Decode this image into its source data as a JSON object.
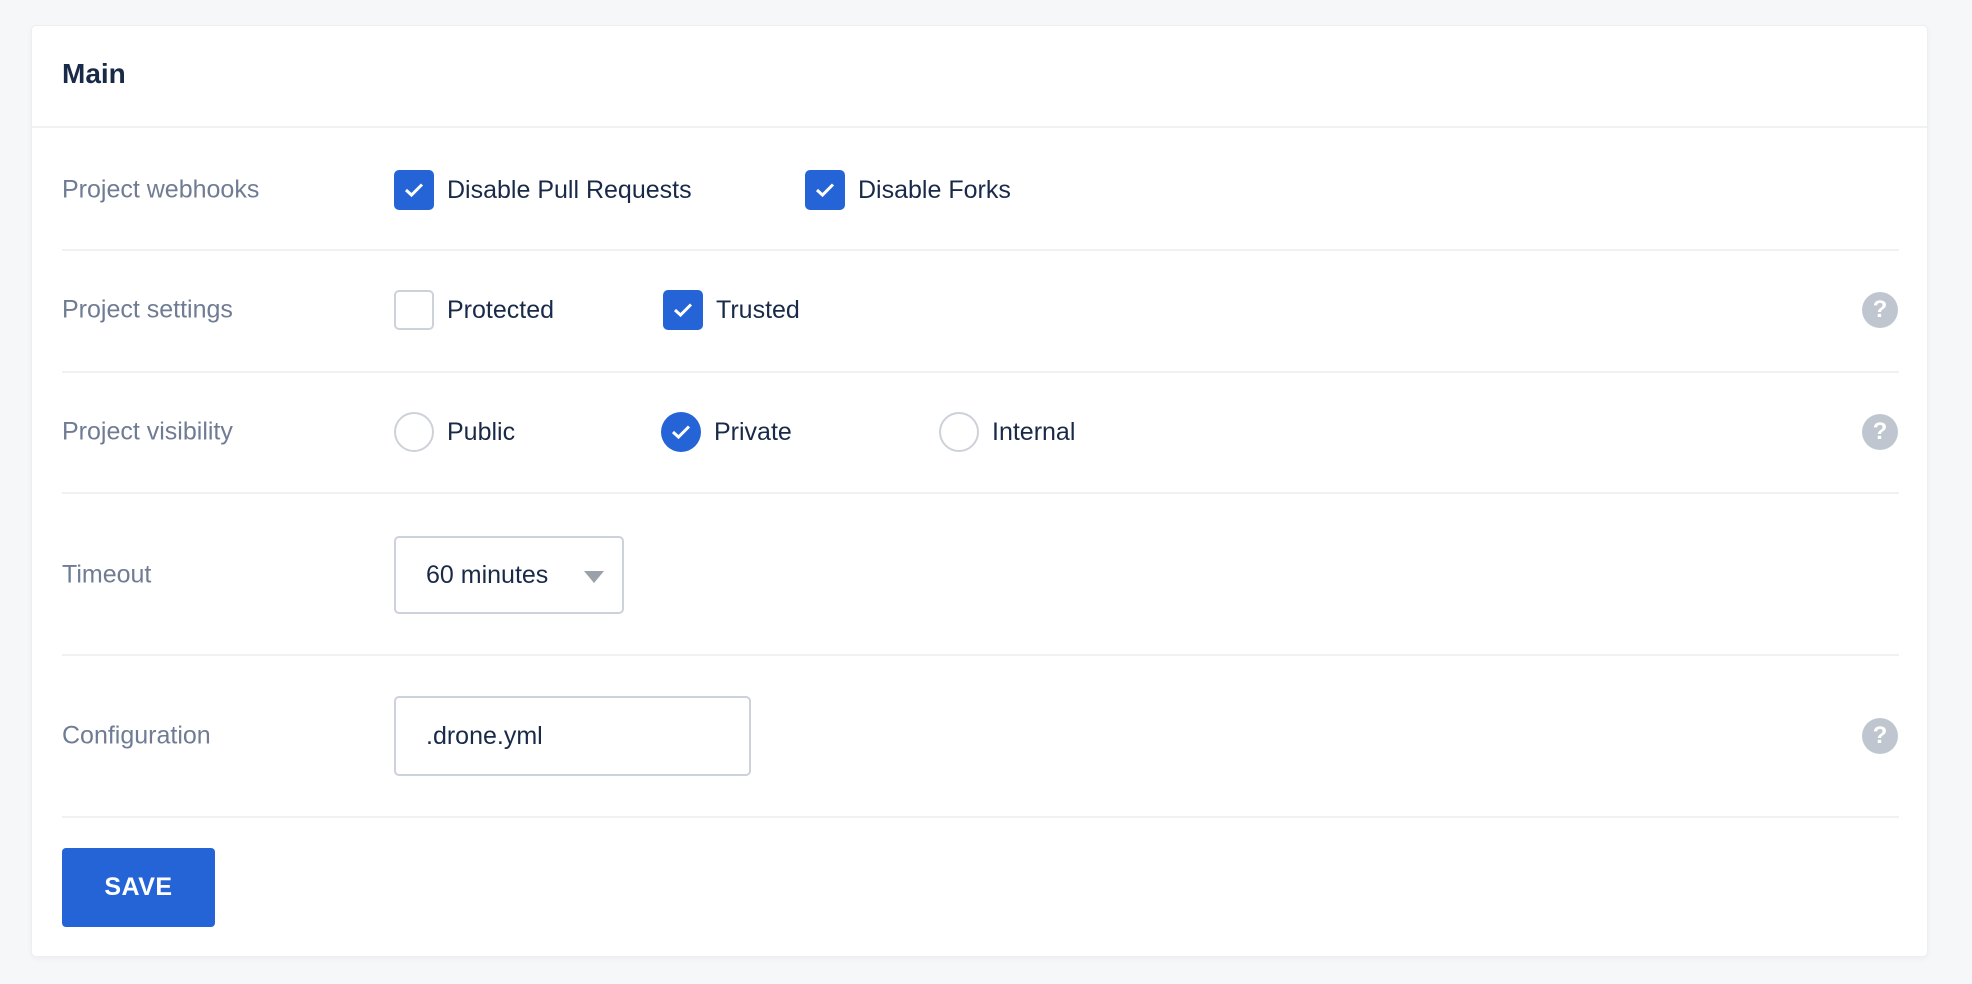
{
  "card": {
    "title": "Main"
  },
  "rows": {
    "webhooks": {
      "label": "Project webhooks",
      "options": [
        {
          "label": "Disable Pull Requests",
          "checked": true
        },
        {
          "label": "Disable Forks",
          "checked": true
        }
      ]
    },
    "settings": {
      "label": "Project settings",
      "options": [
        {
          "label": "Protected",
          "checked": false
        },
        {
          "label": "Trusted",
          "checked": true
        }
      ],
      "help_icon": "question-circle-icon"
    },
    "visibility": {
      "label": "Project visibility",
      "options": [
        {
          "label": "Public",
          "selected": false
        },
        {
          "label": "Private",
          "selected": true
        },
        {
          "label": "Internal",
          "selected": false
        }
      ],
      "help_icon": "question-circle-icon"
    },
    "timeout": {
      "label": "Timeout",
      "value": "60 minutes"
    },
    "configuration": {
      "label": "Configuration",
      "value": ".drone.yml",
      "help_icon": "question-circle-icon"
    }
  },
  "help_glyph": "?",
  "save_label": "SAVE",
  "colors": {
    "accent": "#2564d6",
    "label": "#6f7c93",
    "text": "#192a48",
    "help": "#bfc6cf"
  }
}
